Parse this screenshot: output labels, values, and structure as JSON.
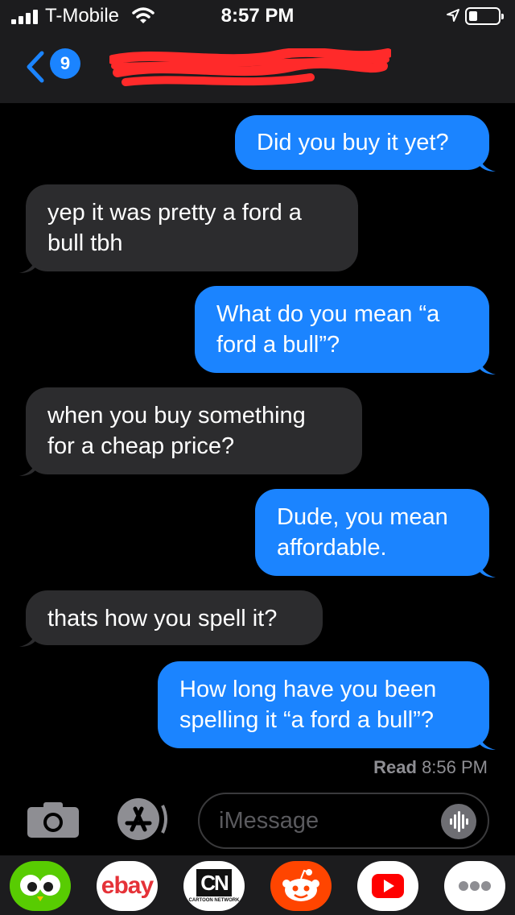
{
  "status_bar": {
    "carrier": "T-Mobile",
    "time": "8:57 PM"
  },
  "nav": {
    "unread_count": "9",
    "contact_name_redacted": true
  },
  "messages": [
    {
      "direction": "outgoing",
      "text": "Did you buy it yet?"
    },
    {
      "direction": "incoming",
      "lines": [
        "yep it was pretty a ford a",
        "bull tbh"
      ]
    },
    {
      "direction": "outgoing",
      "lines": [
        "What do you mean “a",
        "ford a bull”?"
      ]
    },
    {
      "direction": "incoming",
      "lines": [
        "when you buy something",
        "for a cheap price?"
      ]
    },
    {
      "direction": "outgoing",
      "lines": [
        "Dude, you mean",
        "affordable."
      ]
    },
    {
      "direction": "incoming",
      "text": "thats how you spell it?"
    },
    {
      "direction": "outgoing",
      "lines": [
        "How long have you been",
        "spelling it “a ford a bull”?"
      ]
    }
  ],
  "read_receipt": {
    "label": "Read",
    "time": "8:56 PM"
  },
  "composer": {
    "placeholder": "iMessage"
  },
  "app_drawer": {
    "apps": [
      {
        "icon": "duolingo-icon"
      },
      {
        "icon": "ebay-icon",
        "label": "ebay"
      },
      {
        "icon": "cartoon-network-icon",
        "label": "CN",
        "sublabel": "CARTOON NETWORK"
      },
      {
        "icon": "reddit-icon"
      },
      {
        "icon": "youtube-icon"
      },
      {
        "icon": "more-apps-icon"
      }
    ]
  },
  "colors": {
    "outgoing_bubble": "#1b84ff",
    "incoming_bubble": "#2c2c2e",
    "background": "#000000",
    "bar": "#1c1c1e"
  }
}
